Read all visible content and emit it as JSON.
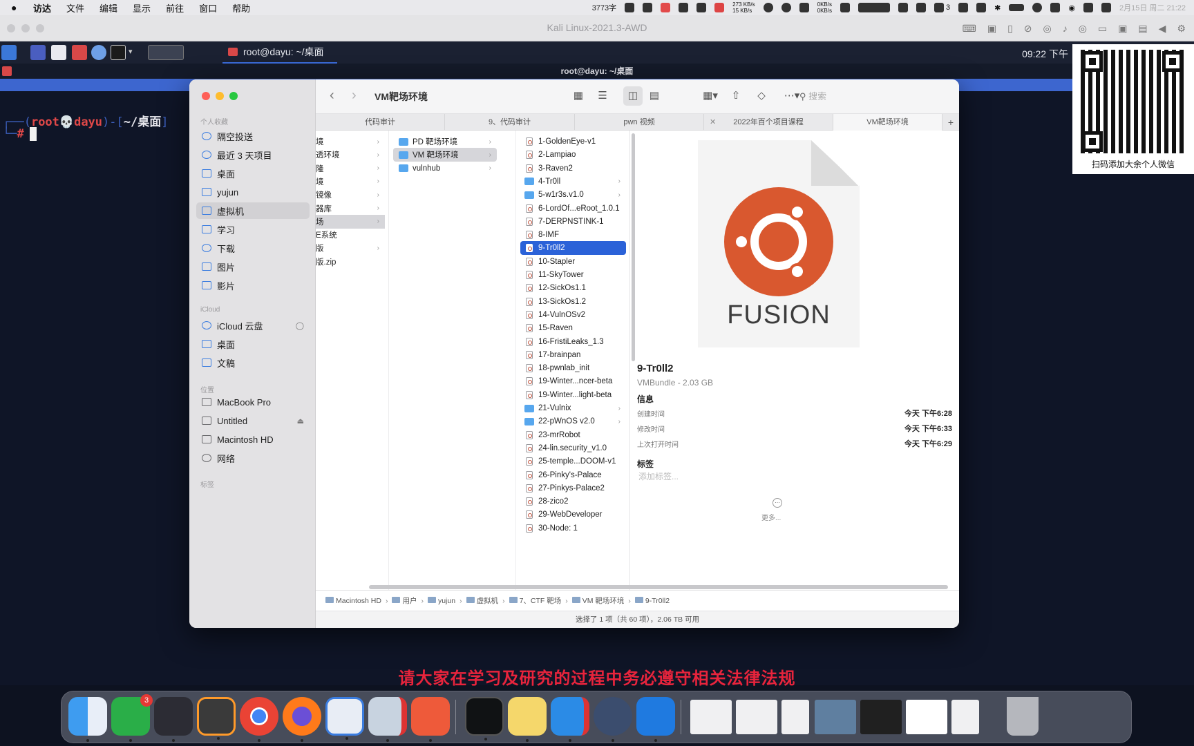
{
  "menubar": {
    "apple": "",
    "items": [
      "访达",
      "文件",
      "编辑",
      "显示",
      "前往",
      "窗口",
      "帮助"
    ],
    "word_count": "3773字",
    "net_up": "273 KB/s",
    "net_down": "15 KB/s",
    "net2_up": "0KB/s",
    "net2_down": "0KB/s",
    "wechat_count": "3",
    "datetime": "2月15日 周二 21:22"
  },
  "vm": {
    "title": "Kali Linux-2021.3-AWD"
  },
  "kali": {
    "task_label": "root@dayu: ~/桌面",
    "clock": "09:22 下午",
    "window_title": "root@dayu: ~/桌面",
    "prompt_user": "root",
    "prompt_skull": "💀",
    "prompt_host": "dayu",
    "prompt_path": "~/桌面",
    "prompt_hash": "#"
  },
  "qr": {
    "caption": "扫码添加大余个人微信"
  },
  "finder": {
    "window_title": "VM靶场环境",
    "search_placeholder": "搜索",
    "sidebar": {
      "favorites_header": "个人收藏",
      "favorites": [
        "隔空投送",
        "最近 3 天项目",
        "桌面",
        "yujun",
        "虚拟机",
        "学习",
        "下载",
        "图片",
        "影片"
      ],
      "icloud_header": "iCloud",
      "icloud": [
        "iCloud 云盘",
        "桌面",
        "文稿"
      ],
      "locations_header": "位置",
      "locations": [
        "MacBook Pro",
        "Untitled",
        "Macintosh HD",
        "网络"
      ],
      "tags_header": "标签"
    },
    "tabs": [
      "代码审计",
      "9、代码审计",
      "pwn 视频",
      "2022年百个项目课程",
      "VM靶场环境"
    ],
    "col1": [
      "境",
      "透环境",
      "隆",
      "境",
      "镜像",
      "器库",
      "场",
      "E系统",
      "版",
      "版.zip"
    ],
    "col2": [
      "PD 靶场环境",
      "VM 靶场环境",
      "vulnhub"
    ],
    "col3": [
      "1-GoldenEye-v1",
      "2-Lampiao",
      "3-Raven2",
      "4-Tr0ll",
      "5-w1r3s.v1.0",
      "6-LordOf...eRoot_1.0.1",
      "7-DERPNSTINK-1",
      "8-IMF",
      "9-Tr0ll2",
      "10-Stapler",
      "11-SkyTower",
      "12-SickOs1.1",
      "13-SickOs1.2",
      "14-VulnOSv2",
      "15-Raven",
      "16-FristiLeaks_1.3",
      "17-brainpan",
      "18-pwnlab_init",
      "19-Winter...ncer-beta",
      "19-Winter...light-beta",
      "21-Vulnix",
      "22-pWnOS v2.0",
      "23-mrRobot",
      "24-lin.security_v1.0",
      "25-temple...DOOM-v1",
      "26-Pinky's-Palace",
      "27-Pinkys-Palace2",
      "28-zico2",
      "29-WebDeveloper",
      "30-Node: 1"
    ],
    "preview": {
      "icon_text": "FUSION",
      "name": "9-Tr0ll2",
      "kind": "VMBundle - 2.03 GB",
      "info_header": "信息",
      "created_label": "创建时间",
      "created_value": "今天 下午6:28",
      "modified_label": "修改时间",
      "modified_value": "今天 下午6:33",
      "opened_label": "上次打开时间",
      "opened_value": "今天 下午6:29",
      "tags_header": "标签",
      "tags_placeholder": "添加标签...",
      "more": "更多..."
    },
    "path": [
      "Macintosh HD",
      "用户",
      "yujun",
      "虚拟机",
      "7、CTF 靶场",
      "VM 靶场环境",
      "9-Tr0ll2"
    ],
    "status": "选择了 1 项（共 60 项），2.06 TB 可用"
  },
  "warning": "请大家在学习及研究的过程中务必遵守相关法律法规",
  "dock": {
    "wechat_badge": "3"
  }
}
